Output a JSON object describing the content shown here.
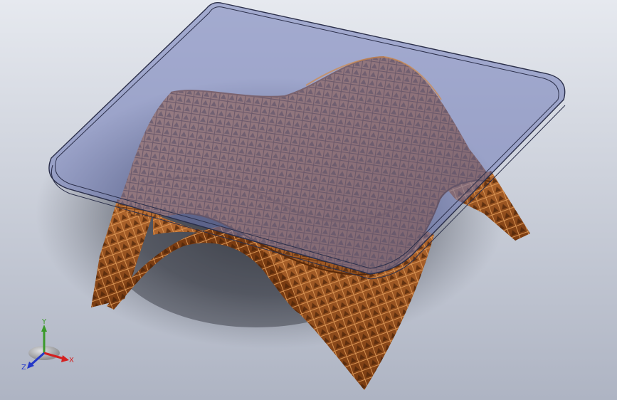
{
  "viewport": {
    "background_top": "#e6e9ef",
    "background_bottom": "#aeb4c3"
  },
  "model": {
    "glass_color": "#6d79b6",
    "glass_edge_color": "#2b2f4a",
    "wood_color": "#b56a30",
    "wood_dark_color": "#6e3610",
    "wood_light_color": "#d08a4c"
  },
  "triad": {
    "x_label": "X",
    "y_label": "Y",
    "z_label": "Z",
    "x_color": "#d42020",
    "y_color": "#3a9a2a",
    "z_color": "#2438c8"
  }
}
